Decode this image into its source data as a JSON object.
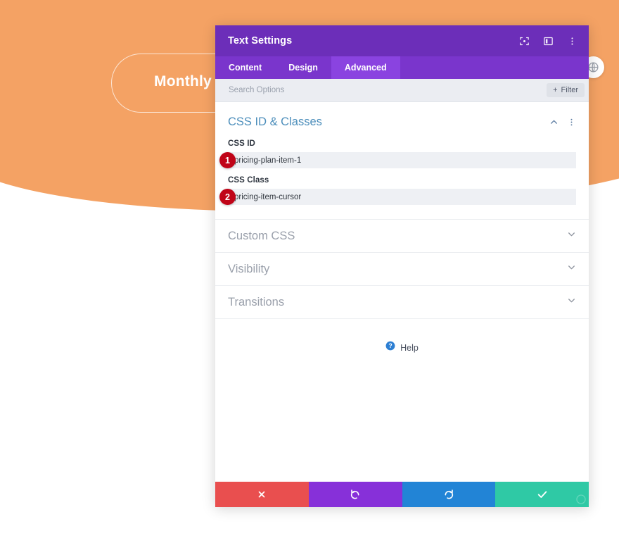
{
  "background": {
    "hero_color": "#f4a264",
    "billing_toggle_label": "Monthly Bi",
    "orbit_button_icon": "globe-icon"
  },
  "modal": {
    "title": "Text Settings",
    "accent_color": "#6c2eb9",
    "titlebar_icons": [
      {
        "name": "focus-target-icon"
      },
      {
        "name": "layout-columns-icon"
      },
      {
        "name": "more-vertical-icon"
      }
    ],
    "tabs": [
      {
        "label": "Content",
        "active": false
      },
      {
        "label": "Design",
        "active": false
      },
      {
        "label": "Advanced",
        "active": true
      }
    ],
    "search": {
      "placeholder": "Search Options",
      "value": "",
      "filter_label": "Filter",
      "filter_plus": "+"
    },
    "open_section": {
      "title": "CSS ID & Classes",
      "collapse_icon": "chevron-up-icon",
      "menu_icon": "more-vertical-icon",
      "fields": [
        {
          "label": "CSS ID",
          "value": "pricing-plan-item-1",
          "badge": "1",
          "badge_color": "#c00418"
        },
        {
          "label": "CSS Class",
          "value": "pricing-item-cursor",
          "badge": "2",
          "badge_color": "#c00418"
        }
      ]
    },
    "collapsed_sections": [
      {
        "label": "Custom CSS",
        "icon": "chevron-down-icon"
      },
      {
        "label": "Visibility",
        "icon": "chevron-down-icon"
      },
      {
        "label": "Transitions",
        "icon": "chevron-down-icon"
      }
    ],
    "help": {
      "label": "Help",
      "icon": "question-circle-icon"
    },
    "footer_buttons": [
      {
        "name": "cancel-button",
        "icon": "close-icon",
        "color": "#e94f4f"
      },
      {
        "name": "undo-button",
        "icon": "undo-icon",
        "color": "#8730d9"
      },
      {
        "name": "redo-button",
        "icon": "redo-icon",
        "color": "#2284d6"
      },
      {
        "name": "save-button",
        "icon": "check-icon",
        "color": "#2fc9a5"
      }
    ]
  }
}
